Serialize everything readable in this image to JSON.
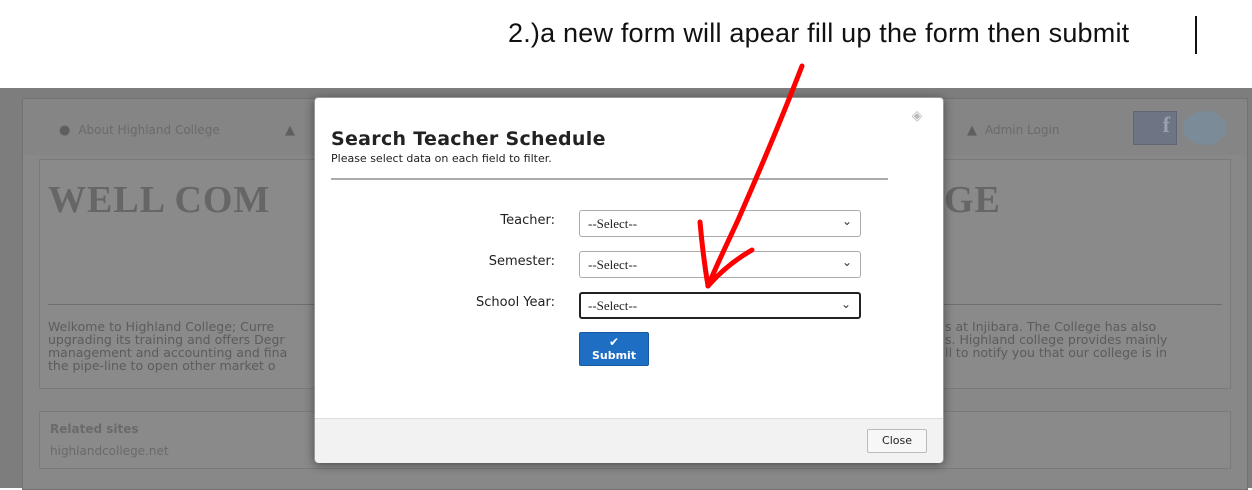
{
  "caption": {
    "text": "2.)a new form will apear fill up the form then submit"
  },
  "background": {
    "nav": {
      "about": "About Highland College",
      "admin_login": "Admin Login"
    },
    "heading_left": "WELL COM",
    "heading_right": "GE",
    "text_left": [
      "Welkome to Highland College; Curre",
      "upgrading its training and offers Degr",
      "management and accounting and fina",
      "the pipe-line to open other market o"
    ],
    "text_right": [
      "s at Injibara. The College has also",
      "s. Highland college provides mainly",
      "ll to notify you that our college is in"
    ],
    "related_title": "Related sites",
    "related_link": "highlandcollege.net"
  },
  "modal": {
    "title": "Search Teacher Schedule",
    "subtitle": "Please select data on each field to filter.",
    "fields": {
      "teacher": {
        "label": "Teacher:",
        "value": "--Select--"
      },
      "semester": {
        "label": "Semester:",
        "value": "--Select--"
      },
      "school_year": {
        "label": "School Year:",
        "value": "--Select--"
      }
    },
    "submit_label": "Submit",
    "close_label": "Close"
  },
  "colors": {
    "annotation_red": "#ff0000",
    "submit_blue": "#1e6fc3",
    "overlay_gray": "#7d7d7d"
  },
  "icons": {
    "help": "help-icon",
    "select_chevron": "chevron-down-icon",
    "submit": "checkmark-icon",
    "nav_about": "info-icon",
    "nav_admin": "user-icon"
  }
}
